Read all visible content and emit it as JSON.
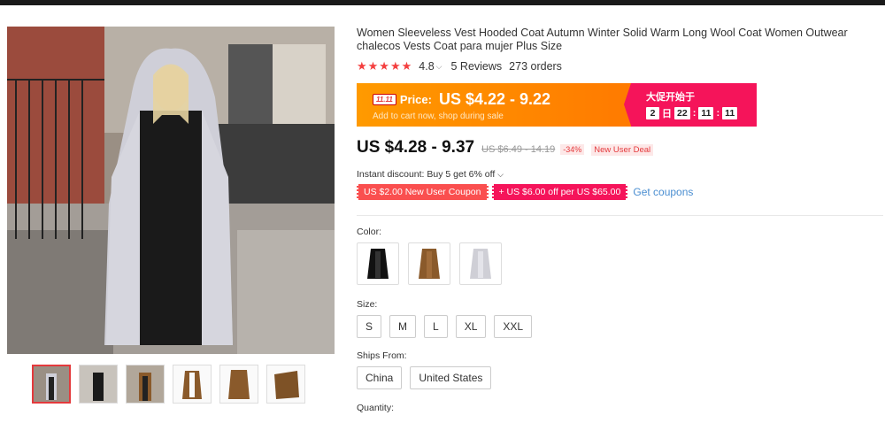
{
  "product": {
    "title": "Women Sleeveless Vest Hooded Coat Autumn Winter Solid Warm Long Wool Coat Women Outwear chalecos Vests Coat para mujer Plus Size",
    "rating": "4.8",
    "reviews": "5 Reviews",
    "orders": "273 orders"
  },
  "promo": {
    "badge": "11.11",
    "price_label": "Price:",
    "price": "US $4.22 - 9.22",
    "subtext": "Add to cart now, shop during sale",
    "sale_title": "大促开始于",
    "countdown": {
      "days": "2",
      "day_unit": "日",
      "hours": "22",
      "minutes": "11",
      "seconds": "11"
    }
  },
  "pricing": {
    "price": "US $4.28 - 9.37",
    "original": "US $6.49 - 14.19",
    "discount": "-34%",
    "new_user_deal": "New User Deal"
  },
  "instant_discount": "Instant discount: Buy 5 get 6% off",
  "coupons": {
    "new_user": "US $2.00 New User Coupon",
    "store": "+ US $6.00 off per US $65.00",
    "get_coupons": "Get coupons"
  },
  "color": {
    "label": "Color:",
    "options": [
      {
        "name": "black",
        "hex": "#111111"
      },
      {
        "name": "brown",
        "hex": "#8a5a2b"
      },
      {
        "name": "light-gray",
        "hex": "#cfcfd6"
      }
    ]
  },
  "size": {
    "label": "Size:",
    "options": [
      "S",
      "M",
      "L",
      "XL",
      "XXL"
    ]
  },
  "ships_from": {
    "label": "Ships From:",
    "options": [
      "China",
      "United States"
    ]
  },
  "quantity": {
    "label": "Quantity:"
  },
  "colors": {
    "accent_red": "#e4393c",
    "promo_orange": "#ff8c00",
    "promo_pink": "#f5145a",
    "link_blue": "#4a8ed1"
  }
}
